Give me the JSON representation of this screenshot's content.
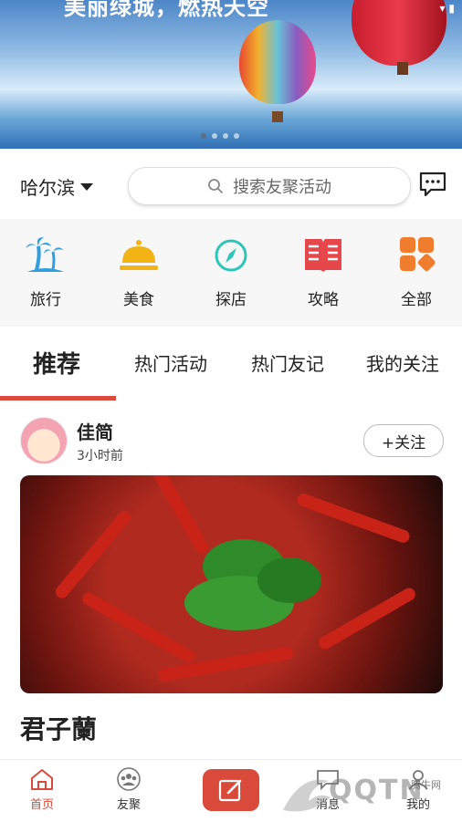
{
  "banner": {
    "title": "美丽绿城，燃热天空"
  },
  "search": {
    "city": "哈尔滨",
    "placeholder": "搜索友聚活动"
  },
  "categories": [
    {
      "label": "旅行",
      "icon": "palm-tree-icon",
      "color": "#2f9fe0"
    },
    {
      "label": "美食",
      "icon": "food-cloche-icon",
      "color": "#f3b315"
    },
    {
      "label": "探店",
      "icon": "compass-icon",
      "color": "#2cc6b8"
    },
    {
      "label": "攻略",
      "icon": "book-icon",
      "color": "#e6474a"
    },
    {
      "label": "全部",
      "icon": "grid-icon",
      "color": "#f07c2e"
    }
  ],
  "tabs": [
    {
      "label": "推荐",
      "active": true
    },
    {
      "label": "热门活动"
    },
    {
      "label": "热门友记"
    },
    {
      "label": "我的关注"
    }
  ],
  "post": {
    "author": "佳简",
    "time": "3小时前",
    "follow_label": "+关注",
    "title": "君子蘭"
  },
  "nav": {
    "items": [
      {
        "label": "首页",
        "active": true,
        "icon": "home-icon"
      },
      {
        "label": "友聚",
        "icon": "group-icon"
      },
      {
        "label": "",
        "icon": "edit-icon"
      },
      {
        "label": "消息",
        "icon": "message-icon"
      },
      {
        "label": "我的",
        "icon": "user-icon"
      }
    ]
  },
  "watermark": {
    "text": "QQTN",
    "small": "腾牛网"
  },
  "colors": {
    "accent": "#d94a3a"
  }
}
